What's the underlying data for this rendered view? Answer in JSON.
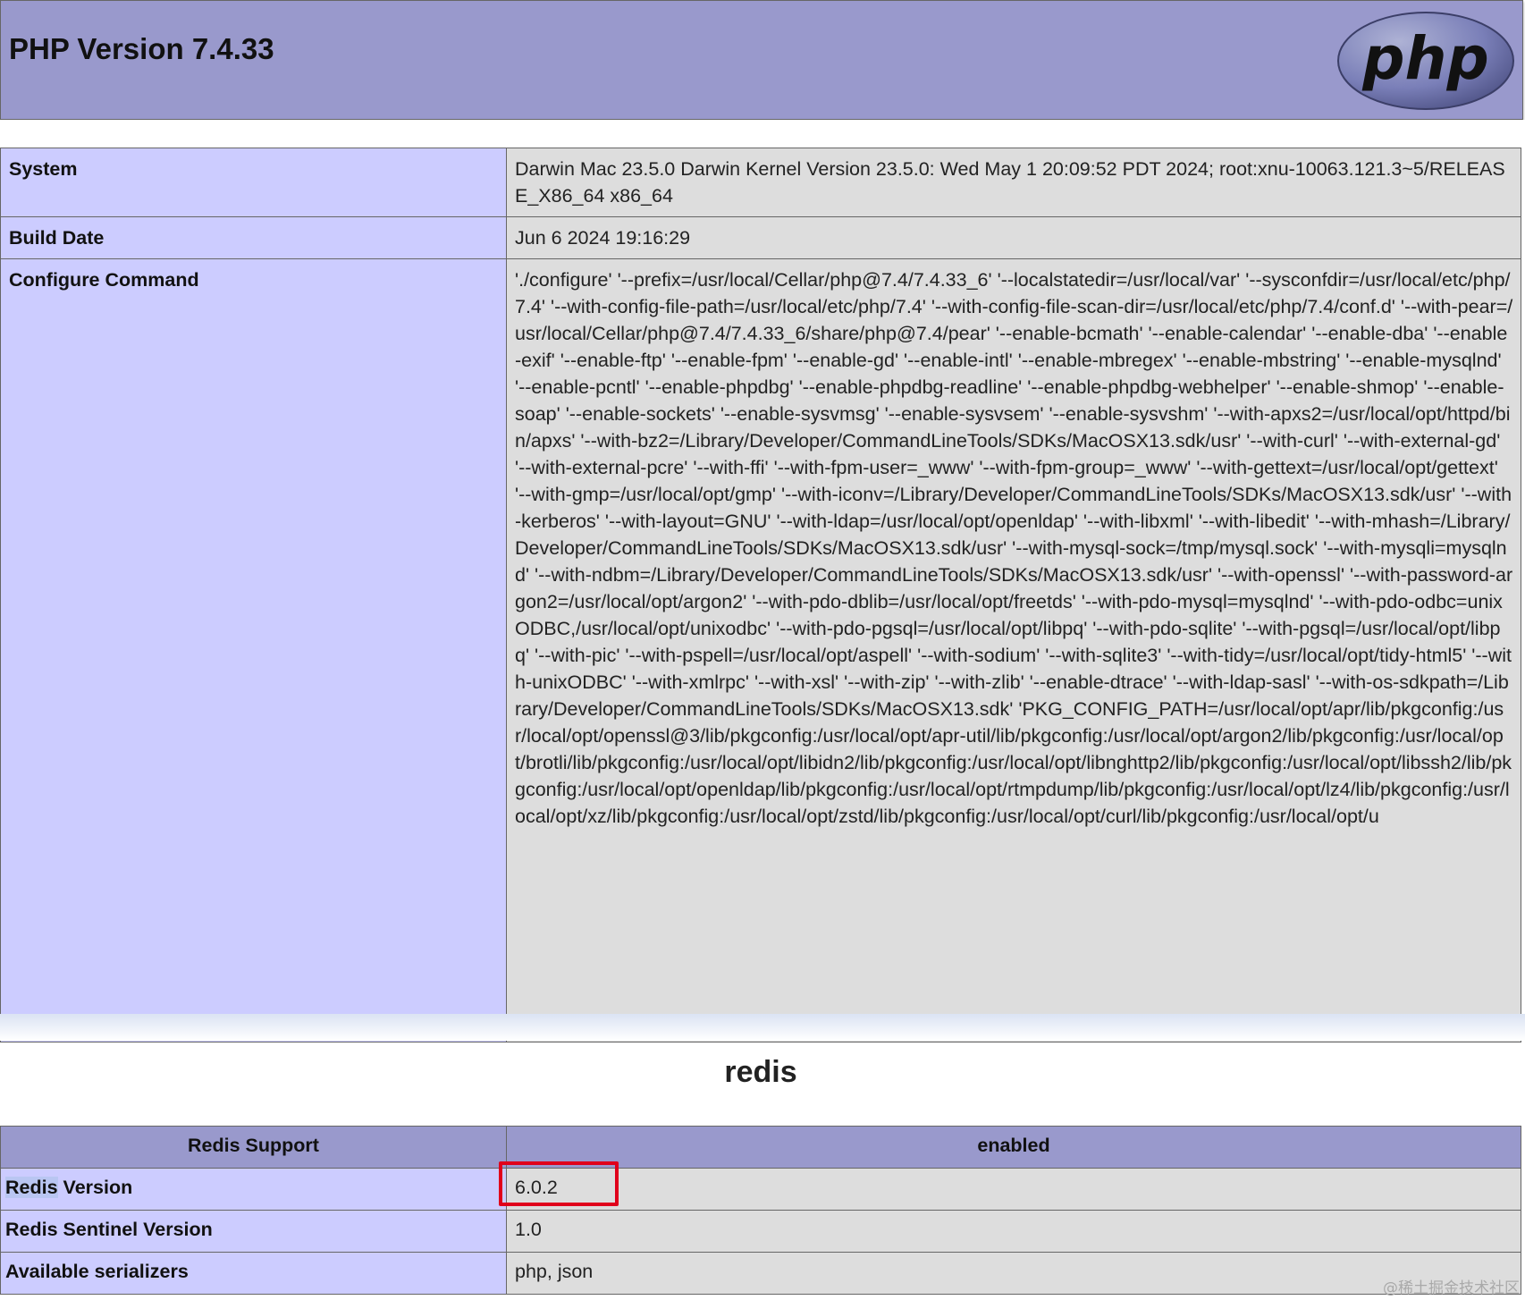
{
  "header": {
    "title": "PHP Version 7.4.33",
    "logo_text": "php"
  },
  "system_table": {
    "rows": [
      {
        "label": "System",
        "value": "Darwin Mac 23.5.0 Darwin Kernel Version 23.5.0: Wed May 1 20:09:52 PDT 2024; root:xnu-10063.121.3~5/RELEASE_X86_64 x86_64"
      },
      {
        "label": "Build Date",
        "value": "Jun 6 2024 19:16:29"
      },
      {
        "label": "Configure Command",
        "value": "'./configure' '--prefix=/usr/local/Cellar/php@7.4/7.4.33_6' '--localstatedir=/usr/local/var' '--sysconfdir=/usr/local/etc/php/7.4' '--with-config-file-path=/usr/local/etc/php/7.4' '--with-config-file-scan-dir=/usr/local/etc/php/7.4/conf.d' '--with-pear=/usr/local/Cellar/php@7.4/7.4.33_6/share/php@7.4/pear' '--enable-bcmath' '--enable-calendar' '--enable-dba' '--enable-exif' '--enable-ftp' '--enable-fpm' '--enable-gd' '--enable-intl' '--enable-mbregex' '--enable-mbstring' '--enable-mysqlnd' '--enable-pcntl' '--enable-phpdbg' '--enable-phpdbg-readline' '--enable-phpdbg-webhelper' '--enable-shmop' '--enable-soap' '--enable-sockets' '--enable-sysvmsg' '--enable-sysvsem' '--enable-sysvshm' '--with-apxs2=/usr/local/opt/httpd/bin/apxs' '--with-bz2=/Library/Developer/CommandLineTools/SDKs/MacOSX13.sdk/usr' '--with-curl' '--with-external-gd' '--with-external-pcre' '--with-ffi' '--with-fpm-user=_www' '--with-fpm-group=_www' '--with-gettext=/usr/local/opt/gettext' '--with-gmp=/usr/local/opt/gmp' '--with-iconv=/Library/Developer/CommandLineTools/SDKs/MacOSX13.sdk/usr' '--with-kerberos' '--with-layout=GNU' '--with-ldap=/usr/local/opt/openldap' '--with-libxml' '--with-libedit' '--with-mhash=/Library/Developer/CommandLineTools/SDKs/MacOSX13.sdk/usr' '--with-mysql-sock=/tmp/mysql.sock' '--with-mysqli=mysqlnd' '--with-ndbm=/Library/Developer/CommandLineTools/SDKs/MacOSX13.sdk/usr' '--with-openssl' '--with-password-argon2=/usr/local/opt/argon2' '--with-pdo-dblib=/usr/local/opt/freetds' '--with-pdo-mysql=mysqlnd' '--with-pdo-odbc=unixODBC,/usr/local/opt/unixodbc' '--with-pdo-pgsql=/usr/local/opt/libpq' '--with-pdo-sqlite' '--with-pgsql=/usr/local/opt/libpq' '--with-pic' '--with-pspell=/usr/local/opt/aspell' '--with-sodium' '--with-sqlite3' '--with-tidy=/usr/local/opt/tidy-html5' '--with-unixODBC' '--with-xmlrpc' '--with-xsl' '--with-zip' '--with-zlib' '--enable-dtrace' '--with-ldap-sasl' '--with-os-sdkpath=/Library/Developer/CommandLineTools/SDKs/MacOSX13.sdk' 'PKG_CONFIG_PATH=/usr/local/opt/apr/lib/pkgconfig:/usr/local/opt/openssl@3/lib/pkgconfig:/usr/local/opt/apr-util/lib/pkgconfig:/usr/local/opt/argon2/lib/pkgconfig:/usr/local/opt/brotli/lib/pkgconfig:/usr/local/opt/libidn2/lib/pkgconfig:/usr/local/opt/libnghttp2/lib/pkgconfig:/usr/local/opt/libssh2/lib/pkgconfig:/usr/local/opt/openldap/lib/pkgconfig:/usr/local/opt/rtmpdump/lib/pkgconfig:/usr/local/opt/lz4/lib/pkgconfig:/usr/local/opt/xz/lib/pkgconfig:/usr/local/opt/zstd/lib/pkgconfig:/usr/local/opt/curl/lib/pkgconfig:/usr/local/opt/u"
      }
    ]
  },
  "redis_section": {
    "title": "redis",
    "header": {
      "label": "Redis Support",
      "value": "enabled"
    },
    "rows": [
      {
        "label_highlight": "Redis",
        "label_rest": " Version",
        "value": "6.0.2"
      },
      {
        "label": "Redis Sentinel Version",
        "value": "1.0"
      },
      {
        "label": "Available serializers",
        "value": "php, json"
      }
    ]
  },
  "watermark": "@稀土掘金技术社区",
  "colors": {
    "header_bg": "#9999cc",
    "label_bg": "#ccccff",
    "value_bg": "#dddddd",
    "highlight_box": "#e0001b"
  }
}
